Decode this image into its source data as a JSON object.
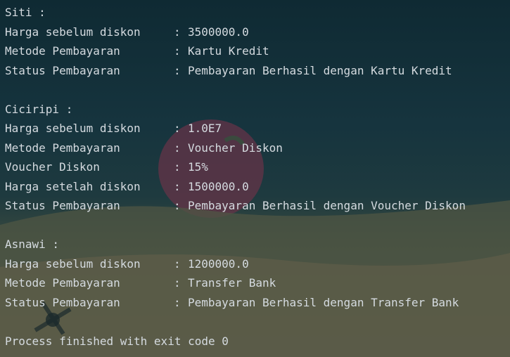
{
  "output": [
    {
      "type": "header",
      "text": "Siti :"
    },
    {
      "type": "row",
      "key": "Harga sebelum diskon",
      "value": "3500000.0"
    },
    {
      "type": "row",
      "key": "Metode Pembayaran",
      "value": "Kartu Kredit"
    },
    {
      "type": "row",
      "key": "Status Pembayaran",
      "value": "Pembayaran Berhasil dengan Kartu Kredit"
    },
    {
      "type": "blank",
      "text": ""
    },
    {
      "type": "header",
      "text": "Ciciripi :"
    },
    {
      "type": "row",
      "key": "Harga sebelum diskon",
      "value": "1.0E7"
    },
    {
      "type": "row",
      "key": "Metode Pembayaran",
      "value": "Voucher Diskon"
    },
    {
      "type": "row",
      "key": "Voucher Diskon",
      "value": "15%"
    },
    {
      "type": "row",
      "key": "Harga setelah diskon",
      "value": "1500000.0"
    },
    {
      "type": "row",
      "key": "Status Pembayaran",
      "value": "Pembayaran Berhasil dengan Voucher Diskon"
    },
    {
      "type": "blank",
      "text": ""
    },
    {
      "type": "header",
      "text": "Asnawi :"
    },
    {
      "type": "row",
      "key": "Harga sebelum diskon",
      "value": "1200000.0"
    },
    {
      "type": "row",
      "key": "Metode Pembayaran",
      "value": "Transfer Bank"
    },
    {
      "type": "row",
      "key": "Status Pembayaran",
      "value": "Pembayaran Berhasil dengan Transfer Bank"
    },
    {
      "type": "blank",
      "text": ""
    },
    {
      "type": "footer",
      "text": "Process finished with exit code 0"
    }
  ],
  "separator": ":"
}
